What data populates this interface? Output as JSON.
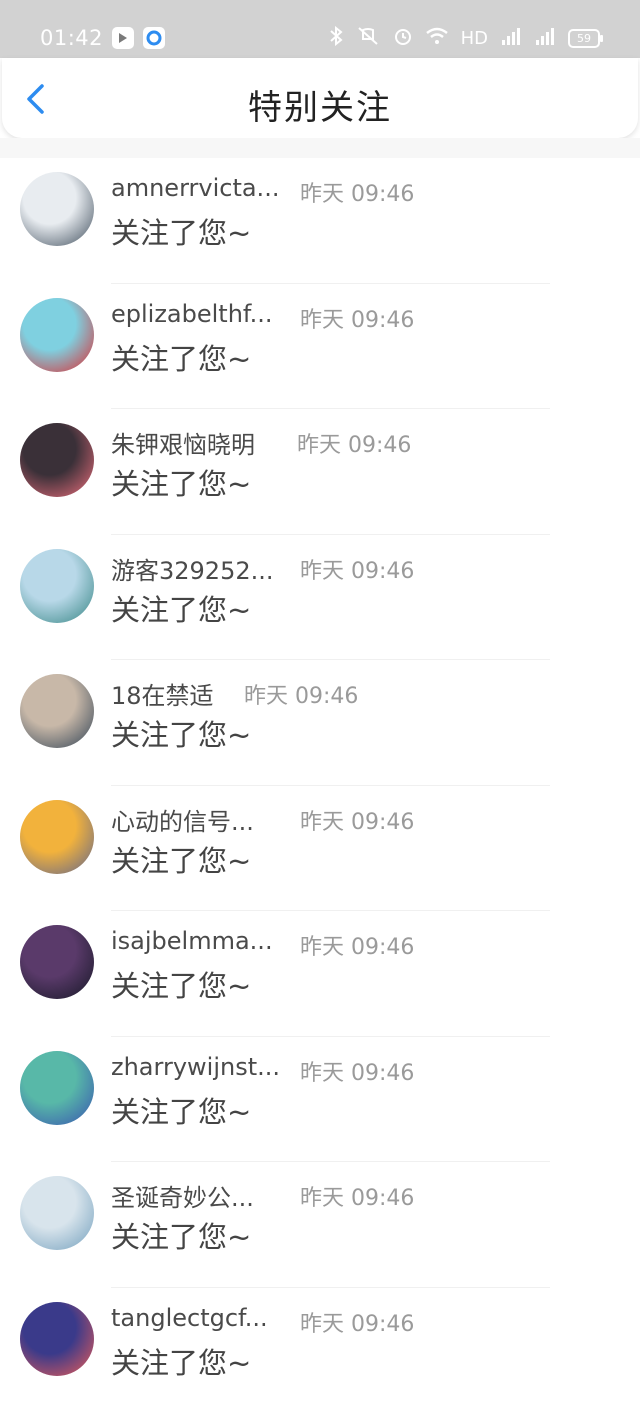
{
  "status_bar": {
    "time": "01:42",
    "network_label": "HD",
    "signal_2g": "2G",
    "signal_4g": "4G",
    "battery": "59"
  },
  "header": {
    "title": "特别关注"
  },
  "items": [
    {
      "name": "amnerrvicta...",
      "time": "昨天 09:46",
      "message": "关注了您~",
      "avatar_colors": [
        "#e8ecf0",
        "#4a5866"
      ]
    },
    {
      "name": "eplizabelthf...",
      "time": "昨天 09:46",
      "message": "关注了您~",
      "avatar_colors": [
        "#7fd0e0",
        "#d8343a"
      ]
    },
    {
      "name": "朱钾艰恼晓明",
      "time": "昨天 09:46",
      "message": "关注了您~",
      "avatar_colors": [
        "#3a3038",
        "#e06a78"
      ]
    },
    {
      "name": "游客329252...",
      "time": "昨天 09:46",
      "message": "关注了您~",
      "avatar_colors": [
        "#b8d8e8",
        "#3e8a8a"
      ]
    },
    {
      "name": "18在禁适",
      "time": "昨天 09:46",
      "message": "关注了您~",
      "avatar_colors": [
        "#c8b8a8",
        "#3a4a5a"
      ]
    },
    {
      "name": "心动的信号...",
      "time": "昨天 09:46",
      "message": "关注了您~",
      "avatar_colors": [
        "#f2b23c",
        "#6a6a88"
      ]
    },
    {
      "name": "isajbelmma...",
      "time": "昨天 09:46",
      "message": "关注了您~",
      "avatar_colors": [
        "#5a3a6a",
        "#1a1a2a"
      ]
    },
    {
      "name": "zharrywijnst...",
      "time": "昨天 09:46",
      "message": "关注了您~",
      "avatar_colors": [
        "#58b8a8",
        "#3a5ab0"
      ]
    },
    {
      "name": "圣诞奇妙公...",
      "time": "昨天 09:46",
      "message": "关注了您~",
      "avatar_colors": [
        "#d8e4ec",
        "#7aa4c0"
      ]
    },
    {
      "name": "tanglectgcf...",
      "time": "昨天 09:46",
      "message": "关注了您~",
      "avatar_colors": [
        "#3a3a8a",
        "#e05a5a"
      ]
    }
  ],
  "colors": {
    "accent": "#2d8cf0",
    "status_bar": "#d2d2d2"
  }
}
